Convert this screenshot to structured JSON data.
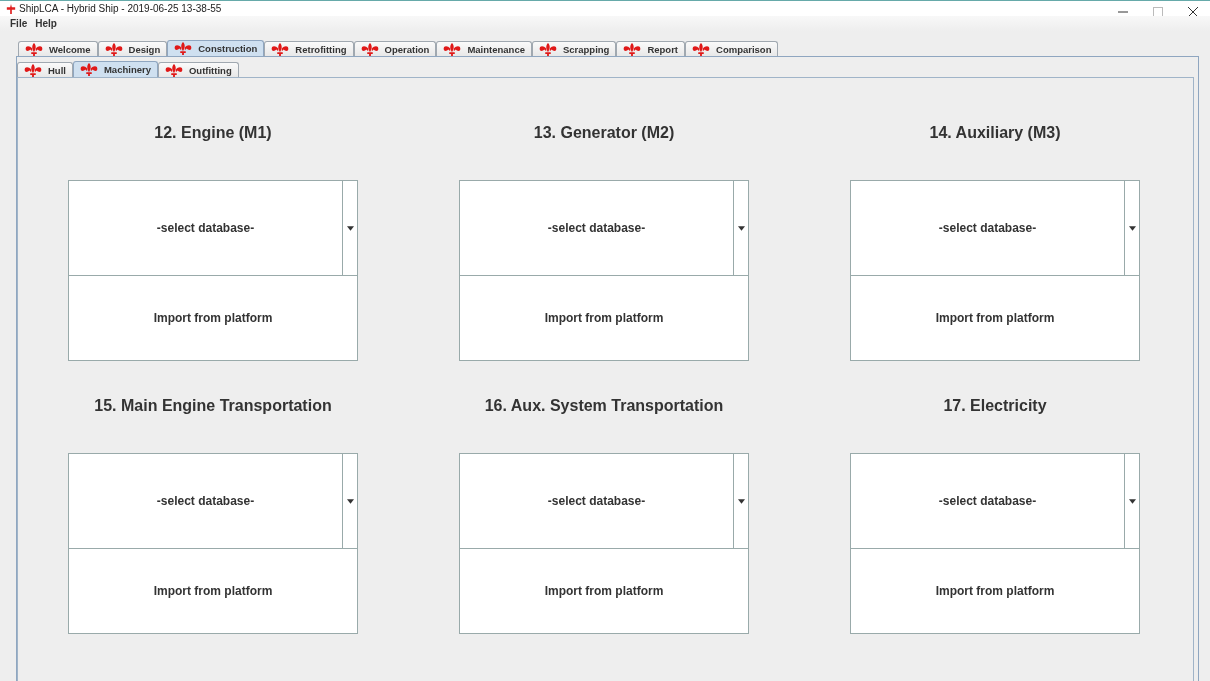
{
  "window": {
    "title": "ShipLCA - Hybrid Ship - 2019-06-25 13-38-55"
  },
  "menu": [
    "File",
    "Help"
  ],
  "tabs": [
    {
      "label": "Welcome",
      "selected": false
    },
    {
      "label": "Design",
      "selected": false
    },
    {
      "label": "Construction",
      "selected": true
    },
    {
      "label": "Retrofitting",
      "selected": false
    },
    {
      "label": "Operation",
      "selected": false
    },
    {
      "label": "Maintenance",
      "selected": false
    },
    {
      "label": "Scrapping",
      "selected": false
    },
    {
      "label": "Report",
      "selected": false
    },
    {
      "label": "Comparison",
      "selected": false
    }
  ],
  "subtabs": [
    {
      "label": "Hull",
      "selected": false
    },
    {
      "label": "Machinery",
      "selected": true
    },
    {
      "label": "Outfitting",
      "selected": false
    }
  ],
  "sections": [
    {
      "title": "12. Engine (M1)",
      "dropdown": "-select database-",
      "button": "Import from platform"
    },
    {
      "title": "13. Generator (M2)",
      "dropdown": "-select database-",
      "button": "Import from platform"
    },
    {
      "title": "14. Auxiliary (M3)",
      "dropdown": "-select database-",
      "button": "Import from platform"
    },
    {
      "title": "15. Main Engine Transportation",
      "dropdown": "-select database-",
      "button": "Import from platform"
    },
    {
      "title": "16. Aux. System Transportation",
      "dropdown": "-select database-",
      "button": "Import from platform"
    },
    {
      "title": "17. Electricity",
      "dropdown": "-select database-",
      "button": "Import from platform"
    }
  ]
}
